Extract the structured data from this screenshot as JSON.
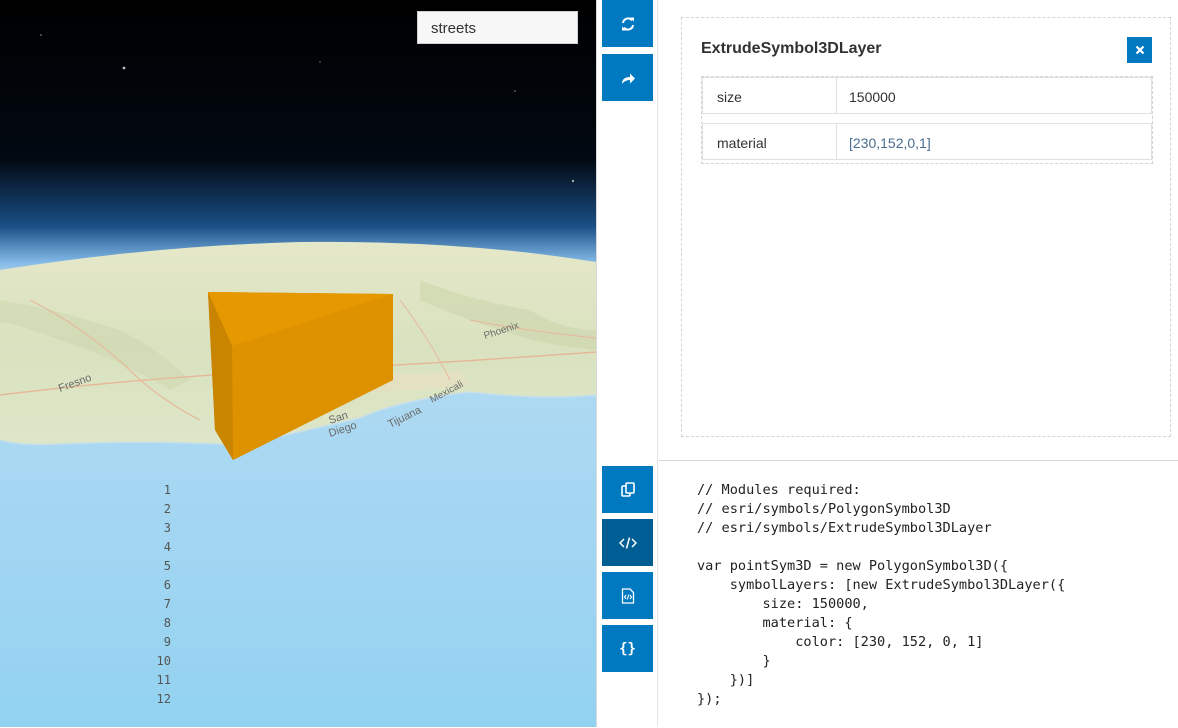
{
  "map": {
    "basemap_value": "streets",
    "place_labels": [
      "Fresno",
      "San",
      "Diego",
      "Tijuana",
      "Mexicali",
      "Phoenix"
    ]
  },
  "toolbar": {
    "top_buttons": [
      {
        "icon": "refresh-icon",
        "name": "refresh-button"
      },
      {
        "icon": "share-icon",
        "name": "share-button"
      }
    ],
    "bottom_buttons": [
      {
        "icon": "copy-icon",
        "name": "copy-button"
      },
      {
        "icon": "code-icon",
        "name": "code-button",
        "active": true
      },
      {
        "icon": "code-file-icon",
        "name": "code-file-button"
      },
      {
        "icon": "json-braces-icon",
        "name": "json-button"
      }
    ]
  },
  "properties": {
    "title": "ExtrudeSymbol3DLayer",
    "close_icon": "close-icon",
    "rows": [
      {
        "key": "size",
        "value": "150000"
      },
      {
        "key": "material",
        "value": "[230,152,0,1]"
      }
    ]
  },
  "code": {
    "lines": [
      {
        "num": "1",
        "text": "// Modules required:"
      },
      {
        "num": "2",
        "text": "// esri/symbols/PolygonSymbol3D"
      },
      {
        "num": "3",
        "text": "// esri/symbols/ExtrudeSymbol3DLayer"
      },
      {
        "num": "4",
        "text": ""
      },
      {
        "num": "5",
        "text": "var pointSym3D = new PolygonSymbol3D({"
      },
      {
        "num": "6",
        "text": "    symbolLayers: [new ExtrudeSymbol3DLayer({"
      },
      {
        "num": "7",
        "text": "        size: 150000,"
      },
      {
        "num": "8",
        "text": "        material: {"
      },
      {
        "num": "9",
        "text": "            color: [230, 152, 0, 1]"
      },
      {
        "num": "10",
        "text": "        }"
      },
      {
        "num": "11",
        "text": "    })]"
      },
      {
        "num": "12",
        "text": "});"
      }
    ]
  },
  "colors": {
    "accent": "#0079c1",
    "accent_active": "#005e95",
    "extrusion": "#e69800",
    "link": "#4a6d90"
  }
}
